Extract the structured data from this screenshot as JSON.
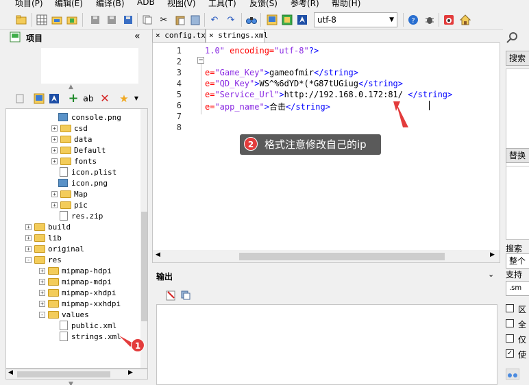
{
  "menu": {
    "items": [
      "项目(P)",
      "编辑(E)",
      "编译(B)",
      "ADB",
      "视图(V)",
      "工具(T)",
      "反馈(S)",
      "参考(R)",
      "帮助(H)"
    ]
  },
  "toolbar": {
    "encoding": "utf-8"
  },
  "project_panel": {
    "title": "项目",
    "collapse": "«",
    "tree": [
      {
        "label": "console.png",
        "kind": "image",
        "expander": ""
      },
      {
        "label": "csd",
        "kind": "folder",
        "expander": "+"
      },
      {
        "label": "data",
        "kind": "folder",
        "expander": "+"
      },
      {
        "label": "Default",
        "kind": "folder",
        "expander": "+"
      },
      {
        "label": "fonts",
        "kind": "folder",
        "expander": "+"
      },
      {
        "label": "icon.plist",
        "kind": "file",
        "expander": ""
      },
      {
        "label": "icon.png",
        "kind": "image",
        "expander": ""
      },
      {
        "label": "Map",
        "kind": "folder",
        "expander": "+"
      },
      {
        "label": "pic",
        "kind": "folder",
        "expander": "+"
      },
      {
        "label": "res.zip",
        "kind": "file",
        "expander": ""
      },
      {
        "label": "build",
        "kind": "folder",
        "expander": "+"
      },
      {
        "label": "lib",
        "kind": "folder",
        "expander": "+"
      },
      {
        "label": "original",
        "kind": "folder",
        "expander": "+"
      },
      {
        "label": "res",
        "kind": "folder",
        "expander": "-"
      },
      {
        "label": "mipmap-hdpi",
        "kind": "folder",
        "expander": "+"
      },
      {
        "label": "mipmap-mdpi",
        "kind": "folder",
        "expander": "+"
      },
      {
        "label": "mipmap-xhdpi",
        "kind": "folder",
        "expander": "+"
      },
      {
        "label": "mipmap-xxhdpi",
        "kind": "folder",
        "expander": "+"
      },
      {
        "label": "values",
        "kind": "folder",
        "expander": "-"
      },
      {
        "label": "public.xml",
        "kind": "file",
        "expander": ""
      },
      {
        "label": "strings.xml",
        "kind": "file",
        "expander": ""
      }
    ]
  },
  "editor": {
    "tabs": [
      {
        "close": "×",
        "label": "config.txt"
      },
      {
        "close": "×",
        "label": "strings.xml"
      }
    ],
    "line_numbers": [
      "1",
      "2",
      "3",
      "4",
      "5",
      "6",
      "7",
      "8"
    ],
    "lines": [
      [
        {
          "t": "1.0\"",
          "c": "val"
        },
        {
          "t": " encoding=",
          "c": "attr"
        },
        {
          "t": "\"utf-8\"",
          "c": "val"
        },
        {
          "t": "?>",
          "c": "tag"
        }
      ],
      [],
      [
        {
          "t": "e=",
          "c": "attr"
        },
        {
          "t": "\"Game_Key\"",
          "c": "val"
        },
        {
          "t": ">",
          "c": "tag"
        },
        {
          "t": "gameofmir",
          "c": "txt"
        },
        {
          "t": "</string>",
          "c": "tag"
        }
      ],
      [
        {
          "t": "e=",
          "c": "attr"
        },
        {
          "t": "\"QD_Key\"",
          "c": "val"
        },
        {
          "t": ">",
          "c": "tag"
        },
        {
          "t": "WS^%6dYD*(*G87tUGiug",
          "c": "txt"
        },
        {
          "t": "</string>",
          "c": "tag"
        }
      ],
      [
        {
          "t": "e=",
          "c": "attr"
        },
        {
          "t": "\"Service_Url\"",
          "c": "val"
        },
        {
          "t": ">",
          "c": "tag"
        },
        {
          "t": "http://192.168.0.172:81/",
          "c": "txt"
        },
        {
          "t": " </string>",
          "c": "tag"
        }
      ],
      [
        {
          "t": "e=",
          "c": "attr"
        },
        {
          "t": "\"app_name\"",
          "c": "val"
        },
        {
          "t": ">",
          "c": "tag"
        },
        {
          "t": "合击",
          "c": "txt"
        },
        {
          "t": "</string>",
          "c": "tag"
        }
      ],
      [],
      []
    ]
  },
  "annotations": {
    "callout_badge": "2",
    "callout_text": "格式注意修改自己的ip",
    "tree_badge": "1",
    "arrow_color": "#e33c3c"
  },
  "output_panel": {
    "title": "输出",
    "collapse": "⌄"
  },
  "search_panel": {
    "search_button": "搜索",
    "replace_button": "替换",
    "scope_label": "搜索",
    "scope_select": "整个",
    "support_label": "支持",
    "support_select": ".sm",
    "checkboxes": [
      {
        "label": "区",
        "checked": false
      },
      {
        "label": "全",
        "checked": false
      },
      {
        "label": "仅",
        "checked": false
      },
      {
        "label": "使",
        "checked": true
      }
    ]
  },
  "colors": {
    "xml_attr": "#ff0000",
    "xml_value": "#8a2be2",
    "xml_tag": "#0000ff",
    "folder": "#f3cc5a"
  }
}
